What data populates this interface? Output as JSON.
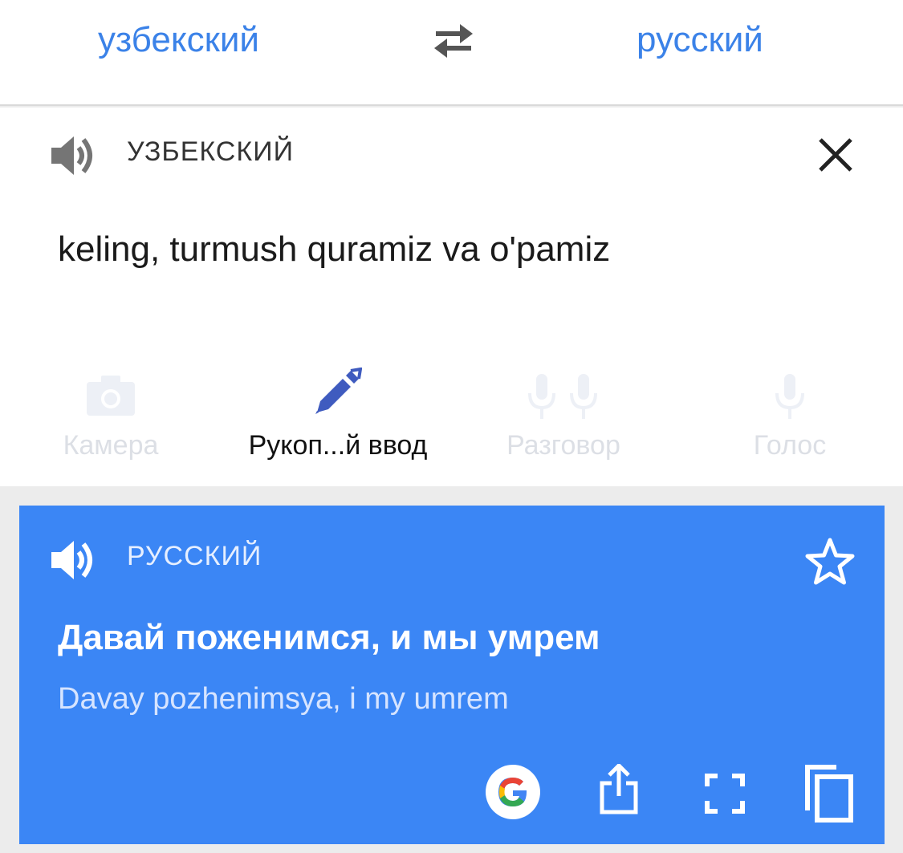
{
  "lang_bar": {
    "source_lang": "узбекский",
    "target_lang": "русский"
  },
  "input": {
    "header_label": "УЗБЕКСКИЙ",
    "text": "keling, turmush quramiz va o'pamiz"
  },
  "tools": [
    {
      "label": "Камера",
      "icon": "camera-icon",
      "state": "disabled"
    },
    {
      "label": "Рукоп...й ввод",
      "icon": "pen-icon",
      "state": "active"
    },
    {
      "label": "Разговор",
      "icon": "conversation-mic-icon",
      "state": "disabled"
    },
    {
      "label": "Голос",
      "icon": "mic-icon",
      "state": "disabled"
    }
  ],
  "result": {
    "header_label": "РУССКИЙ",
    "translation": "Давай поженимся, и мы умрем",
    "transliteration": "Davay pozhenimsya, i my umrem",
    "actions": [
      "google-icon",
      "share-icon",
      "fullscreen-icon",
      "copy-icon"
    ]
  },
  "colors": {
    "accent": "#3b82e8",
    "result_bg": "#3b86f5",
    "pen": "#3f5bbf"
  }
}
